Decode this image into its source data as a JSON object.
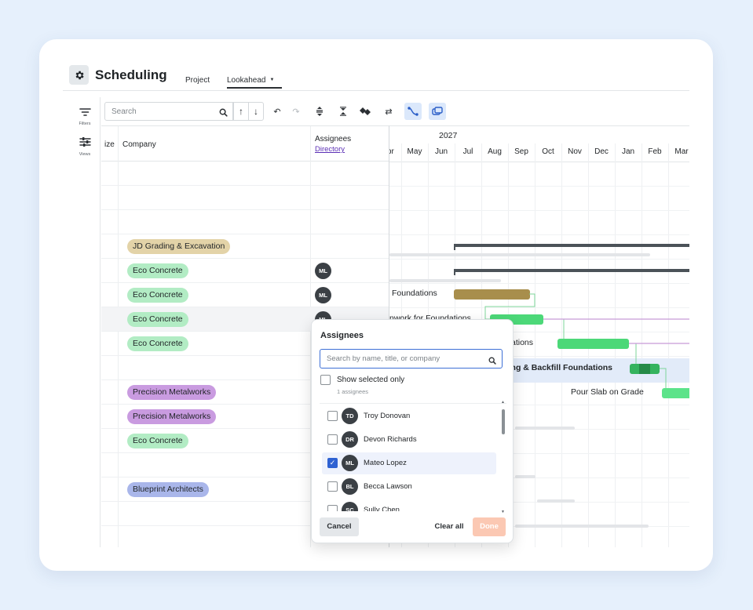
{
  "header": {
    "title": "Scheduling",
    "tabs": {
      "project": "Project",
      "lookahead": "Lookahead"
    }
  },
  "rail": {
    "filters": "Filters",
    "views": "Views"
  },
  "toolbar": {
    "search_placeholder": "Search"
  },
  "columns": {
    "size": "ize",
    "company": "Company",
    "assignees": "Assignees",
    "directory": "Directory"
  },
  "rows": [
    {
      "company": "",
      "assignee": ""
    },
    {
      "company": "",
      "assignee": ""
    },
    {
      "company": "",
      "assignee": ""
    },
    {
      "company": "JD Grading & Excavation",
      "assignee": ""
    },
    {
      "company": "Eco Concrete",
      "assignee": "ML"
    },
    {
      "company": "Eco Concrete",
      "assignee": "ML"
    },
    {
      "company": "Eco Concrete",
      "assignee": "ML"
    },
    {
      "company": "Eco Concrete",
      "assignee": ""
    },
    {
      "company": "",
      "assignee": ""
    },
    {
      "company": "Precision Metalworks",
      "assignee": ""
    },
    {
      "company": "Precision Metalworks",
      "assignee": ""
    },
    {
      "company": "Eco Concrete",
      "assignee": ""
    },
    {
      "company": "",
      "assignee": ""
    },
    {
      "company": "Blueprint Architects",
      "assignee": ""
    },
    {
      "company": "",
      "assignee": ""
    }
  ],
  "company_colors": {
    "JD Grading & Excavation": "#e3d3a8",
    "Eco Concrete": "#b2ecc4",
    "Precision Metalworks": "#c99be0",
    "Blueprint Architects": "#a9b6ea"
  },
  "gantt": {
    "year": "2027",
    "months": [
      "Apr",
      "May",
      "Jun",
      "Jul",
      "Aug",
      "Sep",
      "Oct",
      "Nov",
      "Dec",
      "Jan",
      "Feb",
      "Mar"
    ],
    "tasks": [
      "Foundations",
      "nwork for Foundations",
      "Pour & Cure Concrete Foundations",
      "Waterproofing & Backfill Foundations",
      "Pour Slab on Grade"
    ]
  },
  "popup": {
    "title": "Assignees",
    "search_placeholder": "Search by name, title, or company",
    "show_selected": "Show selected only",
    "count": "1 assignees",
    "people": [
      {
        "initials": "TD",
        "name": "Troy Donovan",
        "checked": false
      },
      {
        "initials": "DR",
        "name": "Devon Richards",
        "checked": false
      },
      {
        "initials": "ML",
        "name": "Mateo Lopez",
        "checked": true
      },
      {
        "initials": "BL",
        "name": "Becca Lawson",
        "checked": false
      },
      {
        "initials": "SC",
        "name": "Sully Chen",
        "checked": false
      }
    ],
    "cancel": "Cancel",
    "clear_all": "Clear all",
    "done": "Done"
  }
}
